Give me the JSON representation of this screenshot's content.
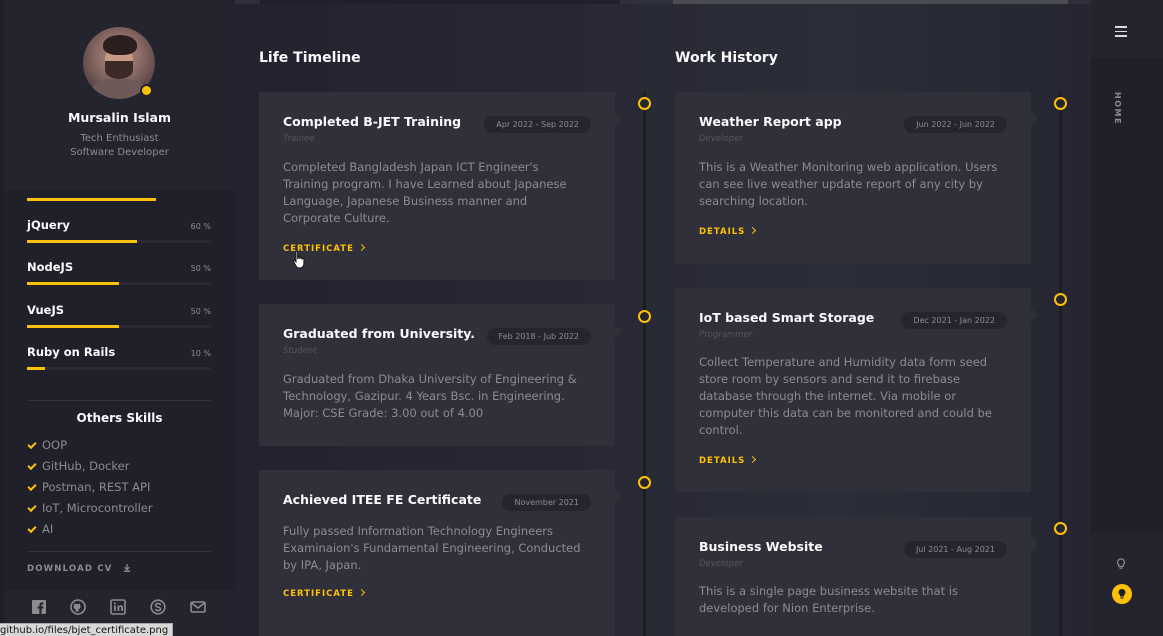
{
  "profile": {
    "name": "Mursalin Islam",
    "roles": [
      "Tech Enthusiast",
      "Software Developer"
    ]
  },
  "skills": [
    {
      "label": "jQuery",
      "percent": "60 %",
      "level": 0.6
    },
    {
      "label": "NodeJS",
      "percent": "50 %",
      "level": 0.5
    },
    {
      "label": "VueJS",
      "percent": "50 %",
      "level": 0.5
    },
    {
      "label": "Ruby on Rails",
      "percent": "10 %",
      "level": 0.1
    }
  ],
  "others": {
    "title": "Others Skills",
    "items": [
      "OOP",
      "GitHub, Docker",
      "Postman, REST API",
      "IoT, Microcontroller",
      "AI"
    ]
  },
  "download_label": "DOWNLOAD CV",
  "timeline": {
    "title": "Life Timeline",
    "items": [
      {
        "title": "Completed B-JET Training",
        "date": "Apr 2022 - Sep 2022",
        "subtitle": "Trainee",
        "body": [
          "Completed Bangladesh Japan ICT Engineer's",
          "Training program. I have Learned about Japanese",
          "Language, Japanese Business manner and",
          "Corporate Culture."
        ],
        "link": "CERTIFICATE"
      },
      {
        "title": "Graduated from University.",
        "date": "Feb 2018 - Jub 2022",
        "subtitle": "Student",
        "body": [
          "Graduated from Dhaka University of Engineering &",
          "Technology, Gazipur. 4 Years Bsc. in Engineering.",
          "Major: CSE Grade: 3.00 out of 4.00"
        ],
        "link": ""
      },
      {
        "title": "Achieved ITEE FE Certificate",
        "date": "November 2021",
        "subtitle": "",
        "body": [
          "Fully passed Information Technology Engineers",
          "Examinaion's Fundamental Engineering, Conducted",
          "by IPA, Japan."
        ],
        "link": "CERTIFICATE"
      }
    ]
  },
  "work": {
    "title": "Work History",
    "items": [
      {
        "title": "Weather Report app",
        "date": "Jun 2022 - Jun 2022",
        "subtitle": "Developer",
        "body": [
          "This is a Weather Monitoring web application. Users",
          "can see live weather update report of any city by",
          "searching location."
        ],
        "link": "DETAILS"
      },
      {
        "title": "IoT based Smart Storage",
        "date": "Dec 2021 - Jan 2022",
        "subtitle": "Programmer",
        "body": [
          "Collect Temperature and Humidity data form seed",
          "store room by sensors and send it to firebase",
          "database through the internet. Via mobile or",
          "computer this data can be monitored and could be",
          "control."
        ],
        "link": "DETAILS"
      },
      {
        "title": "Business Website",
        "date": "Jul 2021 - Aug 2021",
        "subtitle": "Developer",
        "body": [
          "This is a single page business website that is",
          "developed for Nion Enterprise."
        ],
        "link": ""
      }
    ]
  },
  "rail": {
    "home_label": "HOME"
  },
  "status_url": "github.io/files/bjet_certificate.png",
  "colors": {
    "accent": "#ffc107",
    "card": "#30303a",
    "sidebar": "#20202a"
  }
}
